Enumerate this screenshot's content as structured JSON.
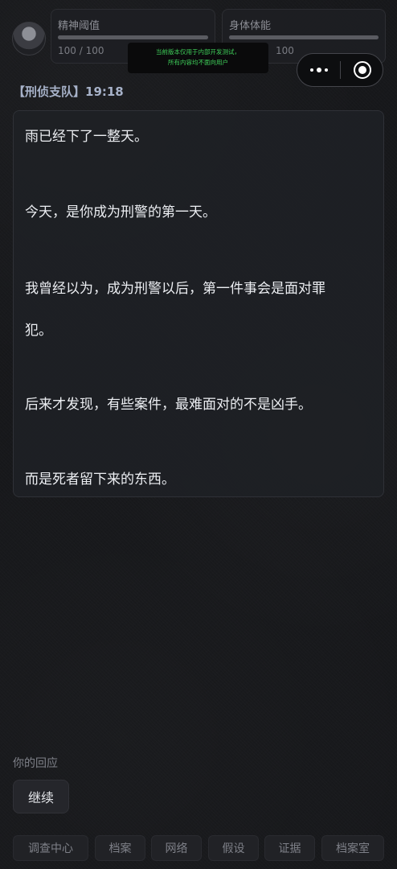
{
  "stats": {
    "sanity": {
      "label": "精神阈值",
      "value": "100 / 100",
      "fill": 1.0
    },
    "physical": {
      "label": "身体体能",
      "value": "100",
      "fill": 1.0
    }
  },
  "dev_notice": {
    "line1": "当前版本仅用于内部开发测试，",
    "line2": "所有内容均不面向用户"
  },
  "header": {
    "text": "【刑侦支队】19:18"
  },
  "story": {
    "p1": "雨已经下了一整天。",
    "p2": "今天，是你成为刑警的第一天。",
    "p3a": "我曾经以为，成为刑警以后，第一件事会是面对罪",
    "p3b": "犯。",
    "p4": "后来才发现，有些案件，最难面对的不是凶手。",
    "p5": "而是死者留下来的东西。"
  },
  "reply": {
    "label": "你的回应",
    "continue": "继续"
  },
  "nav": {
    "investigation": "调查中心",
    "files": "档案",
    "network": "网络",
    "hypothesis": "假设",
    "evidence": "证据",
    "archive_room": "档案室"
  },
  "icons": {
    "avatar": "avatar-portrait",
    "more": "more-dots-icon",
    "close": "target-close-icon"
  }
}
